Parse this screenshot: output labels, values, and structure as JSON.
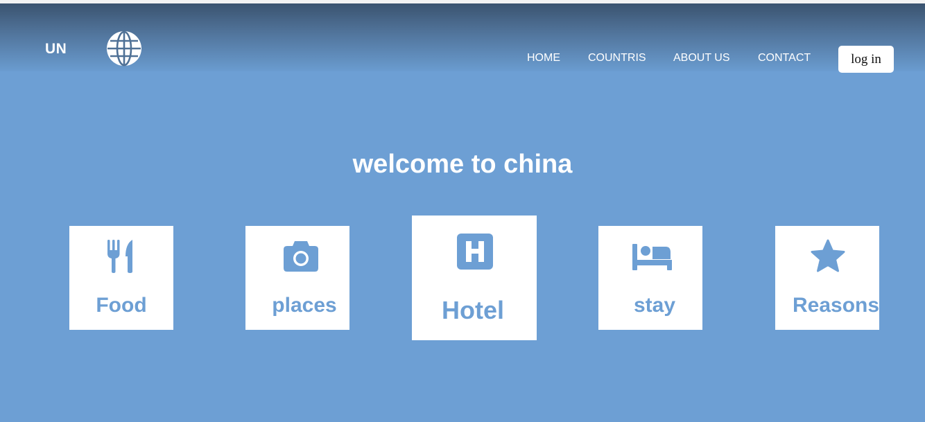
{
  "brand": {
    "logo_text": "UN",
    "logo_icon": "globe-icon"
  },
  "nav": {
    "items": [
      {
        "label": "HOME"
      },
      {
        "label": "COUNTRIS"
      },
      {
        "label": "ABOUT US"
      },
      {
        "label": "CONTACT"
      }
    ],
    "login_label": "log in"
  },
  "hero": {
    "title": "welcome to china"
  },
  "cards": [
    {
      "label": "Food",
      "icon": "utensils-icon"
    },
    {
      "label": "places",
      "icon": "camera-icon"
    },
    {
      "label": "Hotel",
      "icon": "hospital-h-icon"
    },
    {
      "label": "stay",
      "icon": "bed-icon"
    },
    {
      "label": "Reasons",
      "icon": "star-icon"
    }
  ],
  "colors": {
    "background": "#6d9fd4",
    "header_top": "#3a536f",
    "card_bg": "#ffffff",
    "accent": "#6d9fd4"
  }
}
